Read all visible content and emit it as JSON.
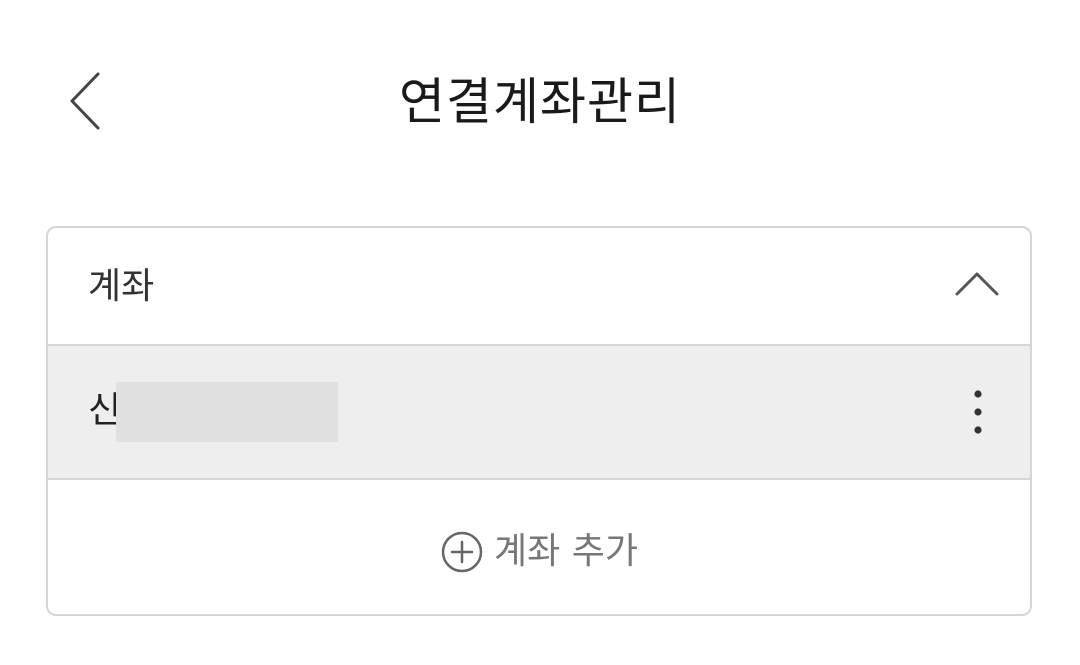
{
  "header": {
    "title": "연결계좌관리",
    "back_icon": "chevron-left-icon"
  },
  "accounts_card": {
    "title": "계좌",
    "collapse_icon": "chevron-up-icon",
    "items": [
      {
        "name_visible": "신",
        "more_icon": "more-vertical-icon"
      }
    ],
    "add_button": {
      "icon": "plus-circle-icon",
      "label": "계좌 추가"
    }
  },
  "colors": {
    "border": "#d6d6d6",
    "row_highlight": "#eeeeee",
    "text_primary": "#1a1a1a",
    "text_muted": "#777777"
  }
}
